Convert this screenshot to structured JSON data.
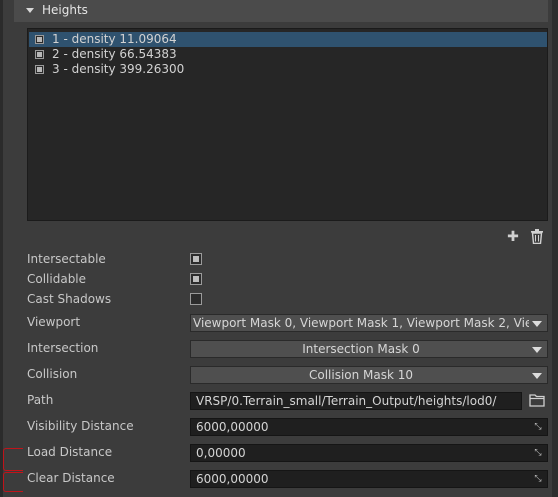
{
  "section": {
    "title": "Heights"
  },
  "heights_list": {
    "items": [
      {
        "label": "1 - density 11.09064",
        "selected": true
      },
      {
        "label": "2 - density 66.54383",
        "selected": false
      },
      {
        "label": "3 - density 399.26300",
        "selected": false
      }
    ]
  },
  "toolbar": {
    "add_icon": "plus-icon",
    "delete_icon": "trash-icon"
  },
  "props": {
    "intersectable": {
      "label": "Intersectable",
      "checked": true
    },
    "collidable": {
      "label": "Collidable",
      "checked": true
    },
    "cast_shadows": {
      "label": "Cast Shadows",
      "checked": false
    },
    "viewport": {
      "label": "Viewport",
      "value": "Viewport Mask 0, Viewport Mask 1, Viewport Mask 2, Vie···"
    },
    "intersection": {
      "label": "Intersection",
      "value": "Intersection Mask 0"
    },
    "collision": {
      "label": "Collision",
      "value": "Collision Mask 10"
    },
    "path": {
      "label": "Path",
      "value": "VRSP/0.Terrain_small/Terrain_Output/heights/lod0/"
    },
    "visibility_distance": {
      "label": "Visibility Distance",
      "value": "6000,00000"
    },
    "load_distance": {
      "label": "Load Distance",
      "value": "0,00000"
    },
    "clear_distance": {
      "label": "Clear Distance",
      "value": "6000,00000"
    }
  },
  "annotation_color": "#c0141a"
}
